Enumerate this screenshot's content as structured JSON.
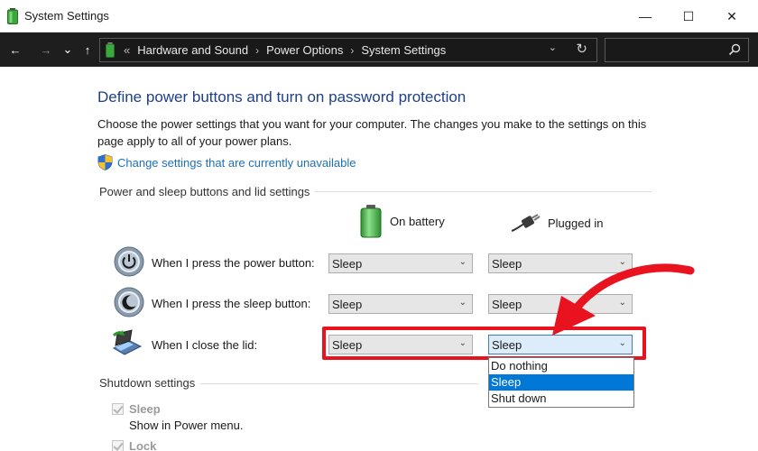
{
  "window": {
    "title": "System Settings",
    "minimize_glyph": "—",
    "maximize_glyph": "☐",
    "close_glyph": "✕"
  },
  "nav": {
    "back_glyph": "←",
    "forward_glyph": "→",
    "recent_glyph": "⌄",
    "up_glyph": "↑",
    "breadcrumb_prefix": "«",
    "breadcrumbs": [
      "Hardware and Sound",
      "Power Options",
      "System Settings"
    ],
    "breadcrumb_separator": "›",
    "dropdown_glyph": "⌄",
    "refresh_glyph": "↻",
    "search_placeholder": ""
  },
  "page": {
    "heading": "Define power buttons and turn on password protection",
    "description": "Choose the power settings that you want for your computer. The changes you make to the settings on this page apply to all of your power plans.",
    "change_link": "Change settings that are currently unavailable",
    "section_power": "Power and sleep buttons and lid settings",
    "col_battery": "On battery",
    "col_plugged": "Plugged in",
    "rows": [
      {
        "label": "When I press the power button:",
        "battery": "Sleep",
        "plugged": "Sleep",
        "icon": "power-button-icon"
      },
      {
        "label": "When I press the sleep button:",
        "battery": "Sleep",
        "plugged": "Sleep",
        "icon": "sleep-button-icon"
      },
      {
        "label": "When I close the lid:",
        "battery": "Sleep",
        "plugged": "Sleep",
        "icon": "laptop-lid-icon"
      }
    ],
    "combo_chevron": "⌄",
    "dropdown_options": [
      "Do nothing",
      "Sleep",
      "Shut down"
    ],
    "dropdown_selected": "Sleep",
    "section_shutdown": "Shutdown settings",
    "shutdown_items": [
      {
        "label": "Sleep",
        "description": "Show in Power menu.",
        "checked": true
      },
      {
        "label": "Lock",
        "checked": true
      }
    ]
  },
  "colors": {
    "heading": "#1e3f8a",
    "link": "#1f6fb5",
    "highlight": "#e8131f",
    "selected_option": "#0078d7"
  }
}
